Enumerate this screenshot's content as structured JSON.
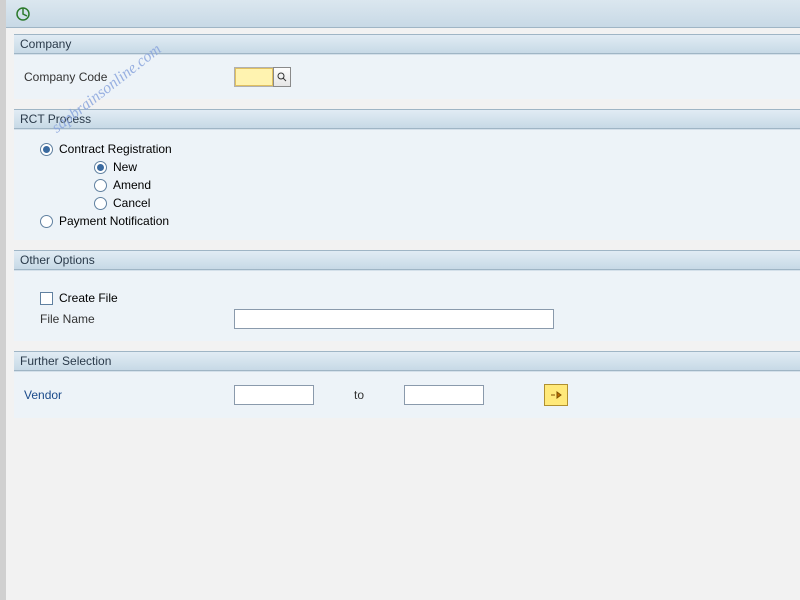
{
  "toolbar": {
    "execute_tip": "Execute"
  },
  "groups": {
    "company": {
      "title": "Company",
      "company_code_label": "Company Code",
      "company_code_value": ""
    },
    "rct": {
      "title": "RCT Process",
      "contract_registration": "Contract Registration",
      "new": "New",
      "amend": "Amend",
      "cancel": "Cancel",
      "payment_notification": "Payment Notification",
      "selected_top": "contract_registration",
      "selected_sub": "new"
    },
    "other": {
      "title": "Other Options",
      "create_file": "Create File",
      "create_file_checked": false,
      "file_name_label": "File Name",
      "file_name_value": ""
    },
    "further": {
      "title": "Further Selection",
      "vendor_label": "Vendor",
      "vendor_from": "",
      "to_label": "to",
      "vendor_to": ""
    }
  },
  "watermark": "sapbrainsonline.com"
}
